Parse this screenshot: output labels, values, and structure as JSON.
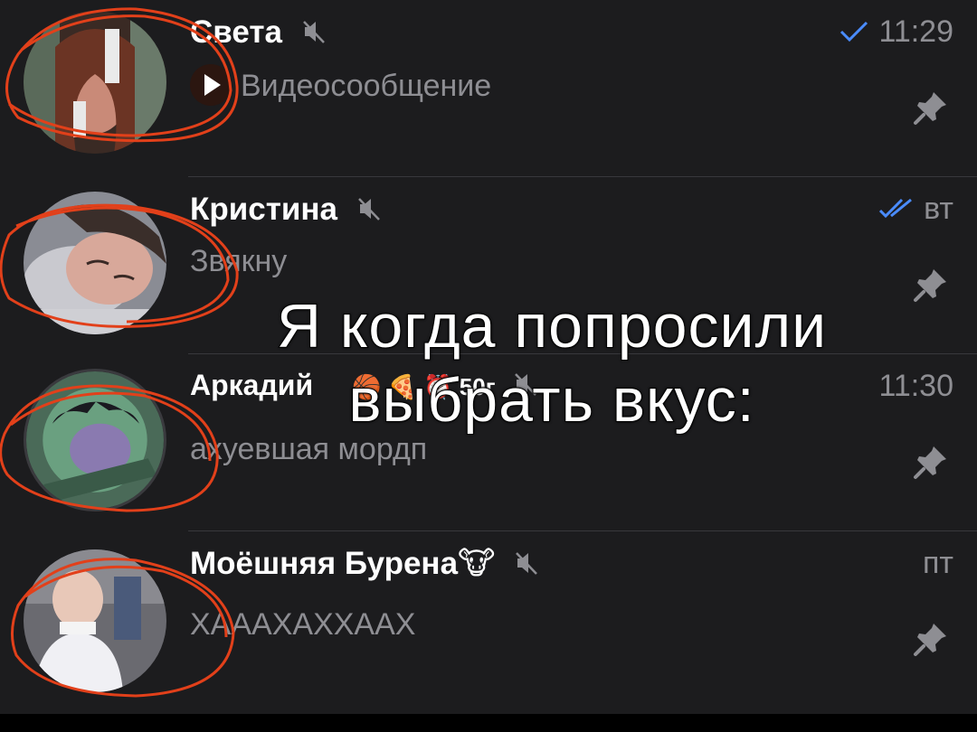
{
  "chats": [
    {
      "name": "Света",
      "time": "11:29",
      "read": "single",
      "preview": "Видеосообщение",
      "preview_type": "video-message",
      "muted": true,
      "pinned": true
    },
    {
      "name": "Кристина",
      "time": "вт",
      "read": "double",
      "preview": "Звякну",
      "muted": true,
      "pinned": true
    },
    {
      "name": "Аркадий",
      "name_suffix": "🏀 🍕 ⏰ 50г",
      "time": "11:30",
      "preview": "ахуевшая мордп",
      "muted": true,
      "pinned": true
    },
    {
      "name": "Моёшняя Бурена🐮",
      "time": "пт",
      "preview": "ХАААХАХХААХ",
      "muted": true,
      "pinned": true
    }
  ],
  "caption": {
    "line1": "Я когда попросили",
    "line2": "выбрать вкус:"
  },
  "colors": {
    "background": "#1c1c1e",
    "secondary_text": "#8e8e93",
    "accent_check": "#4a8cff",
    "scribble": "#e2401a"
  },
  "icons": {
    "mute": "muted-speaker-icon",
    "pin": "pin-icon",
    "read_single": "checkmark-icon",
    "read_double": "double-checkmark-icon",
    "play": "play-icon"
  }
}
